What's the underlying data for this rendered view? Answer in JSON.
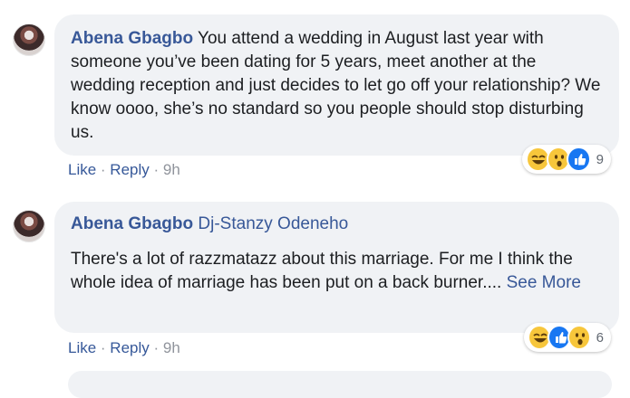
{
  "comments": [
    {
      "author": "Abena Gbagbo",
      "text": " You attend a wedding in August last year with someone you’ve been dating for 5 years, meet another at the wedding reception and just decides to let go off your relationship? We know oooo, she’s no standard so you people should stop disturbing us.",
      "actions": {
        "like": "Like",
        "sep": " · ",
        "reply": "Reply",
        "time": "9h"
      },
      "reactions": {
        "icons": [
          "haha-icon",
          "wow-icon",
          "like-icon"
        ],
        "count": "9"
      }
    },
    {
      "author": "Abena Gbagbo",
      "mention": "Dj-Stanzy Odeneho",
      "text": "There's a lot of razzmatazz about this marriage. For me I think the whole idea of marriage has been put on a back burner....",
      "see_more": "See More",
      "actions": {
        "like": "Like",
        "sep": " · ",
        "reply": "Reply",
        "time": "9h"
      },
      "reactions": {
        "icons": [
          "haha-icon",
          "like-icon",
          "wow-icon"
        ],
        "count": "6"
      }
    }
  ],
  "colors": {
    "link": "#385898",
    "bubble": "#f0f2f5",
    "meta": "#90949c"
  }
}
